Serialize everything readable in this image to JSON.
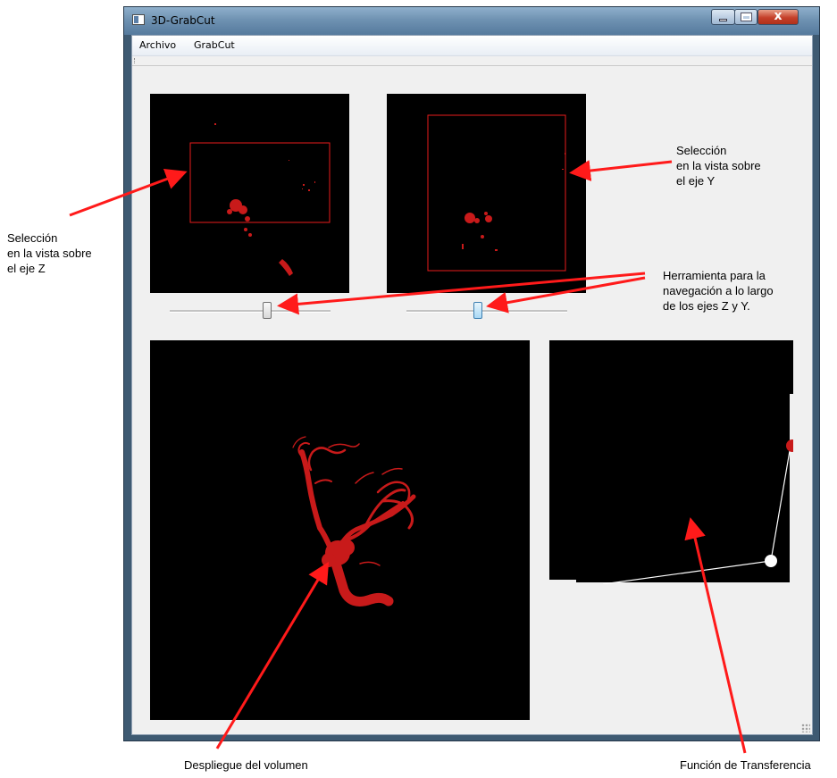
{
  "window": {
    "title": "3D-GrabCut"
  },
  "menu": {
    "items": [
      "Archivo",
      "GrabCut"
    ]
  },
  "sliders": {
    "z_position": 0.61,
    "y_position": 0.44
  },
  "annotations": {
    "z_selection": [
      "Selección",
      "en la vista sobre",
      "el eje Z"
    ],
    "y_selection": [
      "Selección",
      "en la vista sobre",
      "el eje Y"
    ],
    "navigation": [
      "Herramienta para la",
      "navegación a lo largo",
      "de los ejes Z y Y."
    ],
    "volume": "Despliegue del volumen",
    "transfer": "Función de Transferencia"
  },
  "colors": {
    "arrow": "#ff1a1a",
    "selection_box": "#e81b1b",
    "vessel": "#c81a1a",
    "view_background": "#000000",
    "client_background": "#f0f0f0"
  },
  "icons": [
    "app-icon",
    "minimize-icon",
    "maximize-icon",
    "close-icon",
    "resize-grip-icon"
  ]
}
